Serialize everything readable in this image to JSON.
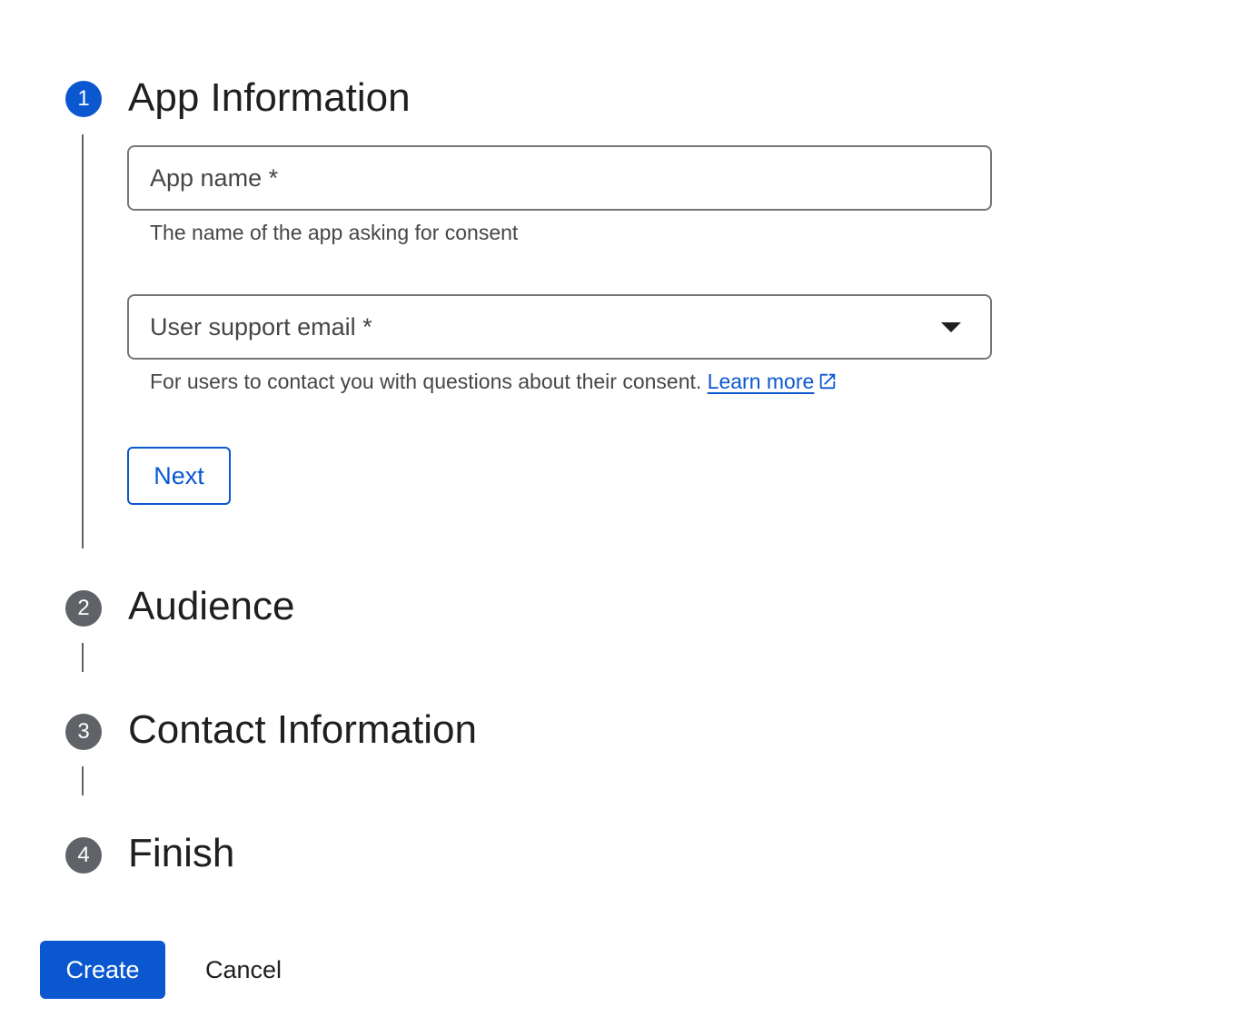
{
  "steps": [
    {
      "number": "1",
      "title": "App Information",
      "state": "active"
    },
    {
      "number": "2",
      "title": "Audience",
      "state": "inactive"
    },
    {
      "number": "3",
      "title": "Contact Information",
      "state": "inactive"
    },
    {
      "number": "4",
      "title": "Finish",
      "state": "inactive"
    }
  ],
  "app_info": {
    "app_name": {
      "label": "App name *",
      "value": "",
      "helper": "The name of the app asking for consent"
    },
    "support_email": {
      "label": "User support email *",
      "value": "",
      "helper": "For users to contact you with questions about their consent.",
      "link_text": "Learn more"
    },
    "next_label": "Next"
  },
  "actions": {
    "create_label": "Create",
    "cancel_label": "Cancel"
  },
  "colors": {
    "primary": "#0b57d0",
    "inactive_step": "#5f6368",
    "text": "#1f1f1f",
    "secondary_text": "#444746"
  },
  "icons": {
    "dropdown": "arrow-drop-down-icon",
    "external_link": "external-link-icon"
  }
}
